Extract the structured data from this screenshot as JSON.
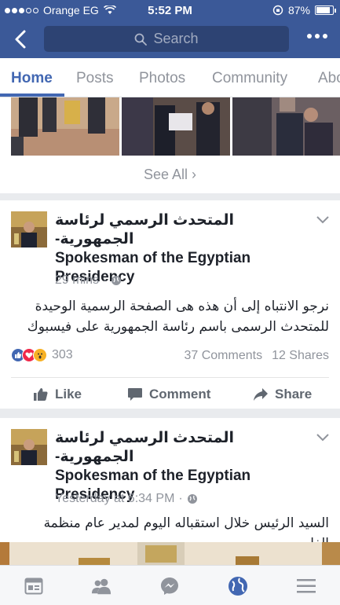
{
  "status_bar": {
    "carrier": "Orange EG",
    "time": "5:52 PM",
    "battery": "87%",
    "battery_level": 0.87
  },
  "search": {
    "placeholder": "Search"
  },
  "tabs": [
    {
      "label": "Home",
      "active": true
    },
    {
      "label": "Posts"
    },
    {
      "label": "Photos"
    },
    {
      "label": "Community"
    },
    {
      "label": "Abo"
    }
  ],
  "photos": {
    "see_all": "See All"
  },
  "posts": [
    {
      "page_name_ar": "المتحدث الرسمي لرئاسة الجمهورية-",
      "page_name_en": "Spokesman of the Egyptian Presidency",
      "time": "29 mins",
      "text_line1": "نرجو الانتباه إلى أن هذه هى الصفحة الرسمية الوحيدة",
      "text_line2": "للمتحدث الرسمى باسم رئاسة الجمهورية على فيسبوك",
      "reactions": "303",
      "comments": "37 Comments",
      "shares": "12 Shares"
    },
    {
      "page_name_ar": "المتحدث الرسمي لرئاسة الجمهورية-",
      "page_name_en": "Spokesman of the Egyptian Presidency",
      "time": "Yesterday at 6:34 PM",
      "text_line1": "السيد الرئيس خلال استقباله اليوم لمدير عام منظمة الفاو"
    }
  ],
  "actions": {
    "like": "Like",
    "comment": "Comment",
    "share": "Share"
  },
  "colors": {
    "brand": "#3b5998",
    "accent": "#4267b2"
  },
  "icons": {
    "bottom_nav": [
      "news-feed-icon",
      "friends-icon",
      "messenger-icon",
      "globe-icon",
      "menu-icon"
    ]
  }
}
